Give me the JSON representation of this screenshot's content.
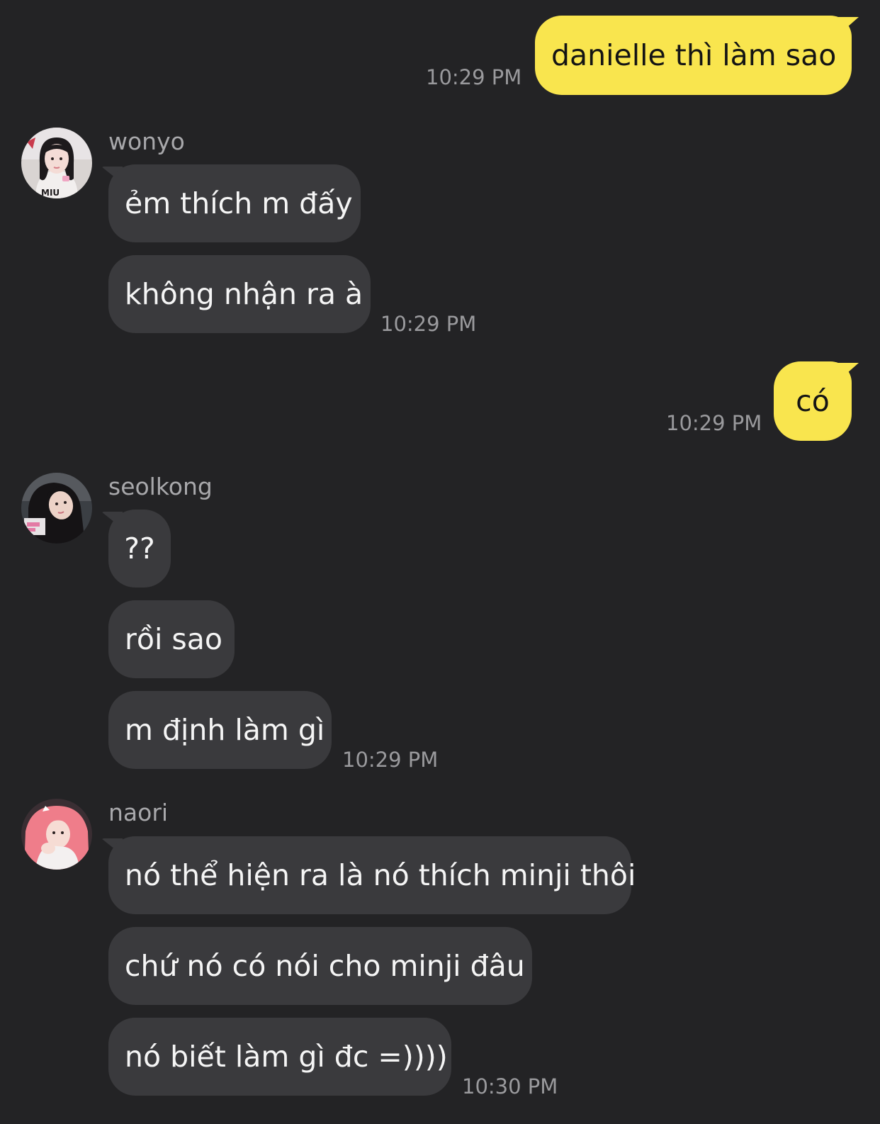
{
  "messages": {
    "m1": {
      "text": "danielle thì làm sao",
      "time": "10:29 PM"
    },
    "wonyo": {
      "name": "wonyo",
      "avatar_icon": "profile-photo-icon",
      "lines": [
        "ẻm thích m đấy",
        "không nhận ra à"
      ],
      "time": "10:29 PM"
    },
    "m2": {
      "text": "có",
      "time": "10:29 PM"
    },
    "seolkong": {
      "name": "seolkong",
      "avatar_icon": "profile-photo-icon",
      "lines": [
        "??",
        "rồi sao",
        "m định làm gì"
      ],
      "time": "10:29 PM"
    },
    "naori": {
      "name": "naori",
      "avatar_icon": "profile-photo-icon",
      "lines": [
        "nó thể hiện ra là nó thích minji thôi",
        "chứ nó có nói cho minji đâu",
        "nó biết làm gì đc =))))"
      ],
      "time": "10:30 PM"
    }
  },
  "colors": {
    "background": "#232325",
    "incoming_bubble": "#3a3a3d",
    "outgoing_bubble": "#f9e54e",
    "timestamp": "#9a9a9d"
  }
}
